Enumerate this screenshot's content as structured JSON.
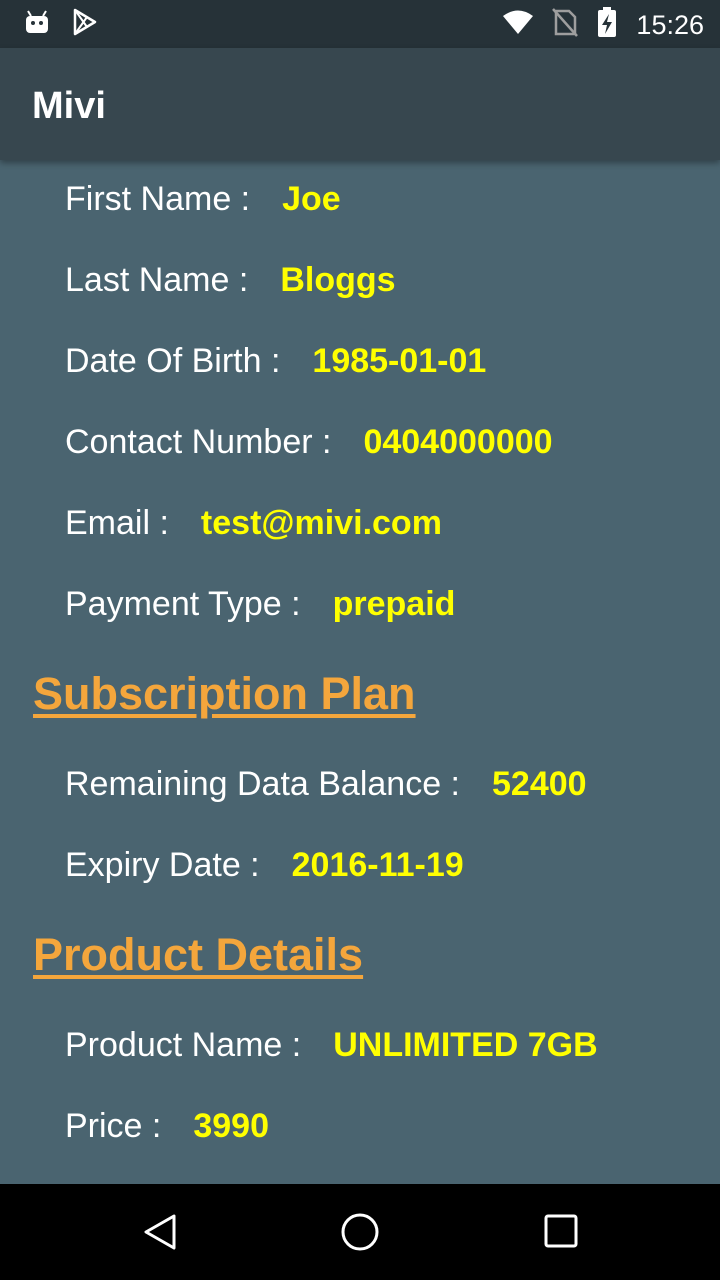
{
  "status_bar": {
    "time": "15:26",
    "left_icons": [
      "android-icon",
      "play-store-icon"
    ],
    "right_icons": [
      "wifi-icon",
      "no-sim-icon",
      "battery-charging-icon"
    ]
  },
  "app_bar": {
    "title": "Mivi"
  },
  "user_info": [
    {
      "label": "First Name :",
      "value": "Joe"
    },
    {
      "label": "Last Name :",
      "value": "Bloggs"
    },
    {
      "label": "Date Of Birth :",
      "value": "1985-01-01"
    },
    {
      "label": "Contact Number :",
      "value": "0404000000"
    },
    {
      "label": "Email :",
      "value": "test@mivi.com"
    },
    {
      "label": "Payment Type :",
      "value": "prepaid"
    }
  ],
  "subscription": {
    "heading": "Subscription Plan",
    "rows": [
      {
        "label": "Remaining Data Balance :",
        "value": "52400"
      },
      {
        "label": "Expiry Date :",
        "value": "2016-11-19"
      }
    ]
  },
  "product": {
    "heading": "Product Details",
    "rows": [
      {
        "label": "Product Name :",
        "value": "UNLIMITED 7GB"
      },
      {
        "label": "Price :",
        "value": "3990"
      }
    ]
  },
  "nav_bar": {
    "buttons": [
      "back-icon",
      "home-icon",
      "recents-icon"
    ]
  },
  "colors": {
    "status_bar": "#263238",
    "app_bar": "#37474f",
    "background": "#4a6470",
    "value_text": "#ffff00",
    "section_heading": "#f4a63c"
  }
}
